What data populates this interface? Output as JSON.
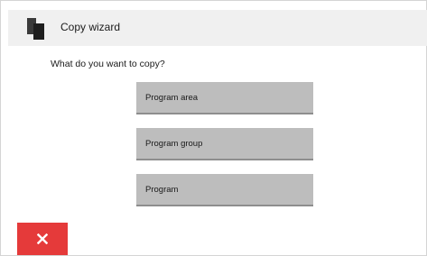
{
  "window": {
    "title": "Copy wizard",
    "icon": "copy-icon"
  },
  "prompt": {
    "question": "What do you want to copy?"
  },
  "options": [
    {
      "label": "Program area"
    },
    {
      "label": "Program group"
    },
    {
      "label": "Program"
    }
  ],
  "footer": {
    "cancel_icon": "close-icon"
  },
  "colors": {
    "header_bg": "#f0f0f0",
    "option_bg": "#bdbdbd",
    "cancel_bg": "#e53a3a"
  }
}
